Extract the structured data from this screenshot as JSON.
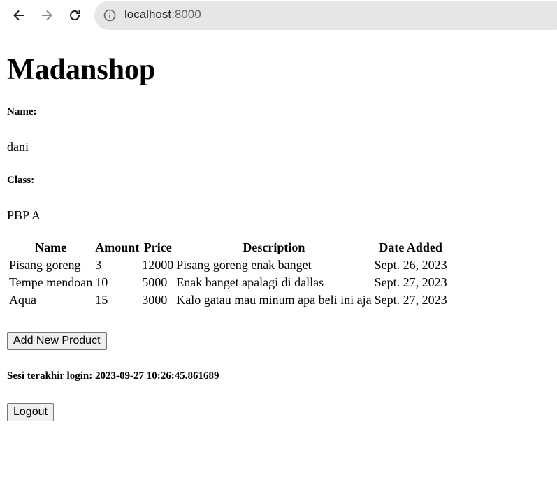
{
  "browser": {
    "url_host": "localhost",
    "url_port": ":8000"
  },
  "page": {
    "title": "Madanshop",
    "name_label": "Name:",
    "name_value": "dani",
    "class_label": "Class:",
    "class_value": "PBP A",
    "table": {
      "headers": [
        "Name",
        "Amount",
        "Price",
        "Description",
        "Date Added"
      ],
      "rows": [
        [
          "Pisang goreng",
          "3",
          "12000",
          "Pisang goreng enak banget",
          "Sept. 26, 2023"
        ],
        [
          "Tempe mendoan",
          "10",
          "5000",
          "Enak banget apalagi di dallas",
          "Sept. 27, 2023"
        ],
        [
          "Aqua",
          "15",
          "3000",
          "Kalo gatau mau minum apa beli ini aja",
          "Sept. 27, 2023"
        ]
      ]
    },
    "add_button_label": "Add New Product",
    "last_login_text": "Sesi terakhir login: 2023-09-27 10:26:45.861689",
    "logout_button_label": "Logout"
  }
}
